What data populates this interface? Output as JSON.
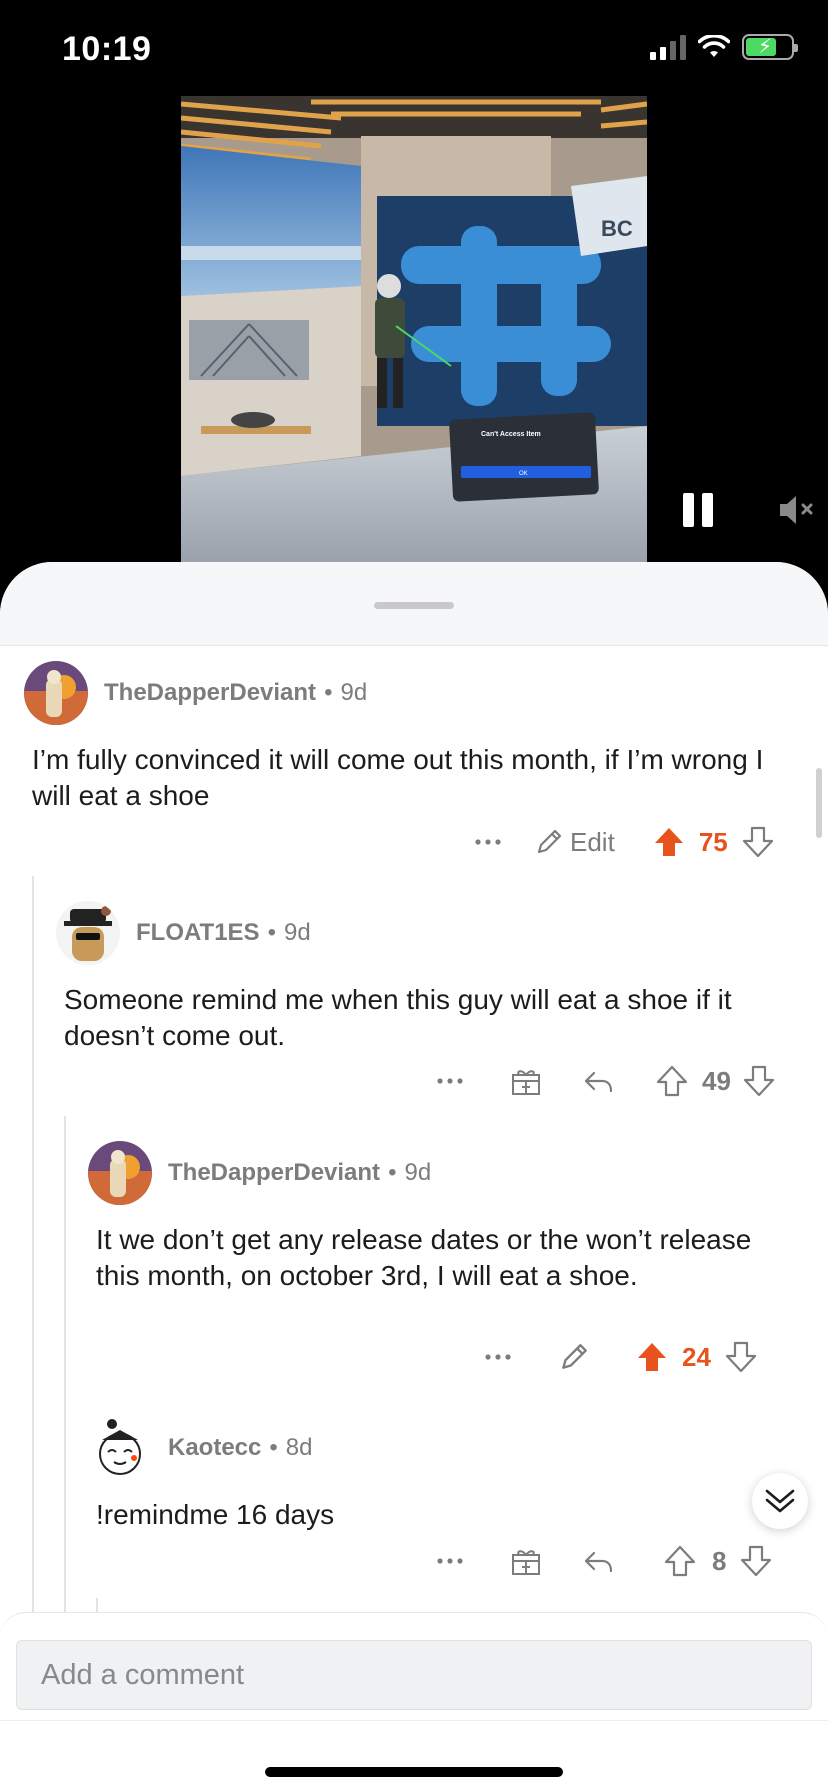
{
  "status_bar": {
    "time": "10:19"
  },
  "video": {
    "dialog_title": "Can't Access Item",
    "dialog_button": "OK",
    "sign_text": "BC"
  },
  "comments": [
    {
      "username": "TheDapperDeviant",
      "age": "9d",
      "body": "I’m fully convinced it will come out this month, if I’m wrong I will eat a shoe",
      "edit_label": "Edit",
      "score": "75",
      "upvoted": true
    },
    {
      "username": "FLOAT1ES",
      "age": "9d",
      "body": "Someone remind me when this guy will eat a shoe if it doesn’t come out.",
      "score": "49",
      "upvoted": false
    },
    {
      "username": "TheDapperDeviant",
      "age": "9d",
      "body": "It we don’t get any release dates or the won’t release this month, on october 3rd, I will eat a shoe.",
      "score": "24",
      "upvoted": true
    },
    {
      "username": "Kaotecc",
      "age": "8d",
      "body": "!remindme 16 days",
      "score": "8",
      "upvoted": false
    }
  ],
  "separator": "•",
  "composer": {
    "placeholder": "Add a comment"
  },
  "colors": {
    "upvote": "#e8531d",
    "meta_text": "#7c7c7c",
    "body_text": "#1c1c1c"
  }
}
